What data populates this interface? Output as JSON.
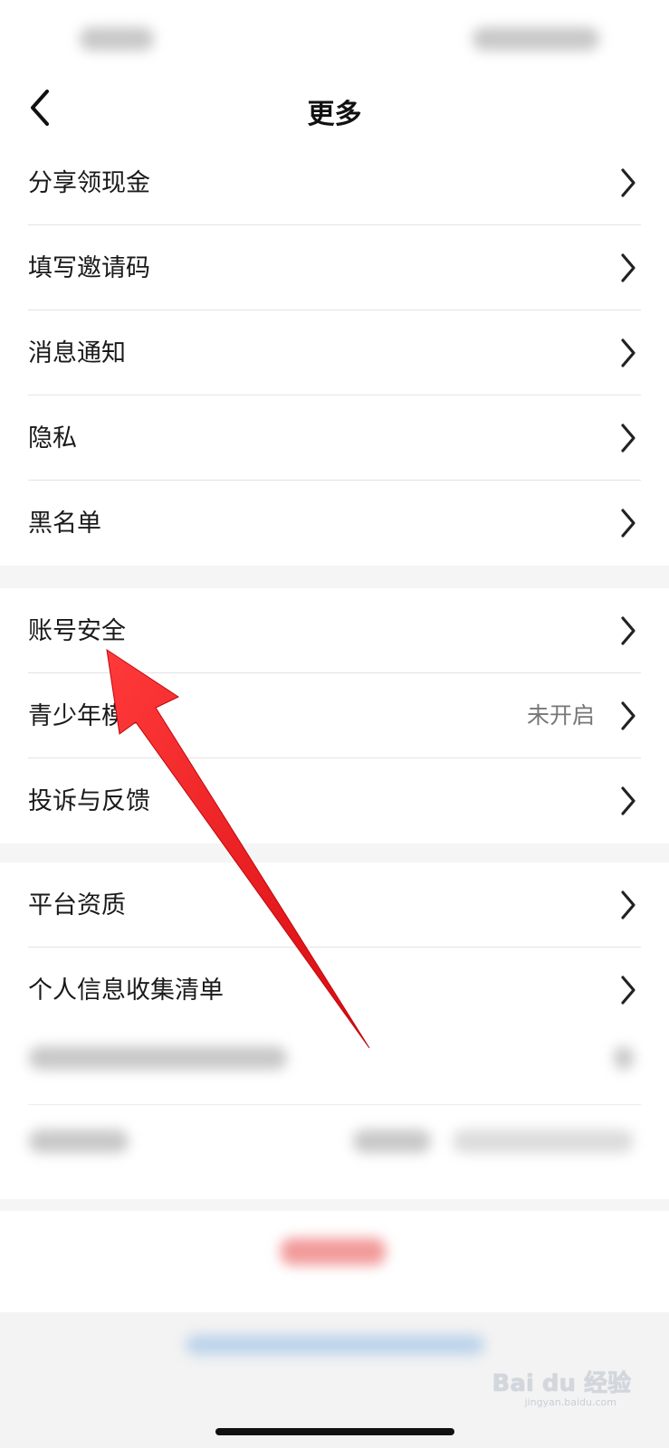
{
  "header": {
    "title": "更多",
    "back_icon": "chevron-left-icon"
  },
  "groups": [
    {
      "items": [
        {
          "label": "分享领现金"
        },
        {
          "label": "填写邀请码"
        },
        {
          "label": "消息通知"
        },
        {
          "label": "隐私"
        },
        {
          "label": "黑名单"
        }
      ]
    },
    {
      "items": [
        {
          "label": "账号安全"
        },
        {
          "label": "青少年模式",
          "value": "未开启"
        },
        {
          "label": "投诉与反馈"
        }
      ]
    },
    {
      "items": [
        {
          "label": "平台资质"
        },
        {
          "label": "个人信息收集清单"
        }
      ]
    }
  ],
  "watermark": {
    "text": "Bai du 经验",
    "sub": "jingyan.baidu.com"
  },
  "colors": {
    "annotation_arrow": "#e8141c",
    "separator": "#e3e3e3",
    "background": "#f5f5f5"
  },
  "icons": {
    "row_chevron": "chevron-right-icon",
    "annotation": "red-arrow-annotation"
  }
}
